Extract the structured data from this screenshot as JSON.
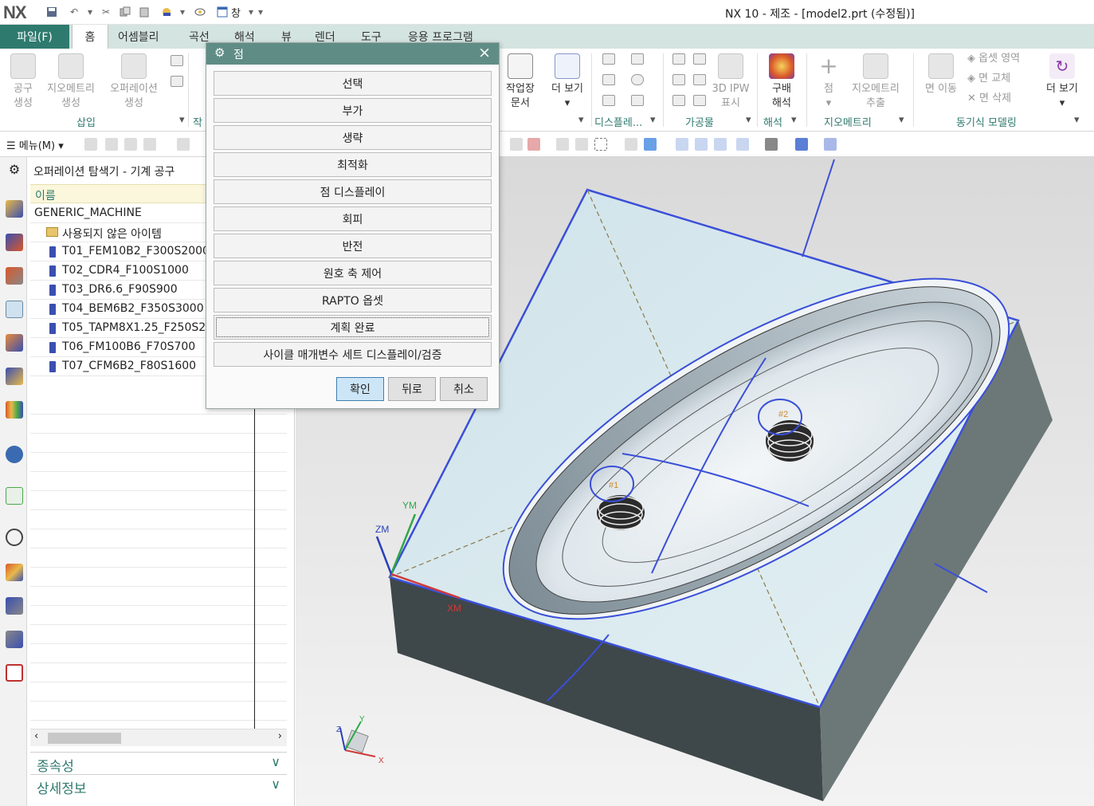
{
  "app": {
    "logo": "NX",
    "window_title": "NX 10 - 제조 - [model2.prt (수정됨)]",
    "window_menu": "창"
  },
  "menu_tabs": {
    "file": "파일(F)",
    "tabs": [
      "홈",
      "어셈블리",
      "곡선",
      "해석",
      "뷰",
      "렌더",
      "도구",
      "응용 프로그램"
    ]
  },
  "ribbon": {
    "buttons": {
      "create_tool_1": "공구",
      "create_tool_2": "생성",
      "create_geometry_1": "지오메트리",
      "create_geometry_2": "생성",
      "create_operation_1": "오퍼레이션",
      "create_operation_2": "생성",
      "shop_doc_1": "작업장",
      "shop_doc_2": "문서",
      "more_view_1": "더 보기",
      "ipw_1": "3D IPW",
      "ipw_2": "표시",
      "draft_1": "구배",
      "draft_2": "해석",
      "point": "점",
      "extract_geometry_1": "지오메트리",
      "extract_geometry_2": "추출",
      "move_face": "면 이동",
      "offset_region": "옵셋 영역",
      "replace_face": "면 교체",
      "delete_face": "면 삭제",
      "more_2": "더 보기"
    },
    "groups": {
      "insert": "삽입",
      "insert_cut": "작",
      "display": "디스플레...",
      "machining": "가공물",
      "analysis": "해석",
      "geometry": "지오메트리",
      "sync_modeling": "동기식 모델링"
    }
  },
  "toolbar2": {
    "menu_label": "메뉴(M)"
  },
  "navigator": {
    "title": "오퍼레이션 탐색기 - 기계 공구",
    "column_name": "이름",
    "root": "GENERIC_MACHINE",
    "items": [
      {
        "label": "사용되지 않은 아이템",
        "icon": "folder-icon"
      },
      {
        "label": "T01_FEM10B2_F300S2000",
        "icon": "end-mill-icon"
      },
      {
        "label": "T02_CDR4_F100S1000",
        "icon": "center-drill-icon"
      },
      {
        "label": "T03_DR6.6_F90S900",
        "icon": "drill-icon"
      },
      {
        "label": "T04_BEM6B2_F350S3000",
        "icon": "end-mill-icon"
      },
      {
        "label": "T05_TAPM8X1.25_F250S200",
        "icon": "tap-icon"
      },
      {
        "label": "T06_FM100B6_F70S700",
        "icon": "face-mill-icon"
      },
      {
        "label": "T07_CFM6B2_F80S1600",
        "icon": "end-mill-icon"
      }
    ],
    "dependency_panel": "종속성",
    "details_panel": "상세정보"
  },
  "dialog": {
    "title": "점",
    "buttons": [
      "선택",
      "부가",
      "생략",
      "최적화",
      "점 디스플레이",
      "회피",
      "반전",
      "원호 축 제어",
      "RAPTO 옵셋",
      "계획 완료",
      "사이클 매개변수 세트 디스플레이/검증"
    ],
    "ok": "확인",
    "back": "뒤로",
    "cancel": "취소"
  },
  "viewport": {
    "axis_labels": {
      "ym": "YM",
      "zm": "ZM",
      "xm": "XM",
      "tri_x": "X",
      "tri_y": "Y",
      "tri_z": "Z"
    },
    "hole_labels": [
      "#1",
      "#2"
    ]
  },
  "colors": {
    "accent": "#2f7a6e",
    "dialog_header": "#5f8d85",
    "selection_blue": "#3a4fd8",
    "part_top": "#d8e9ee",
    "part_side_dark": "#3e4749",
    "part_side_light": "#6c7878"
  }
}
